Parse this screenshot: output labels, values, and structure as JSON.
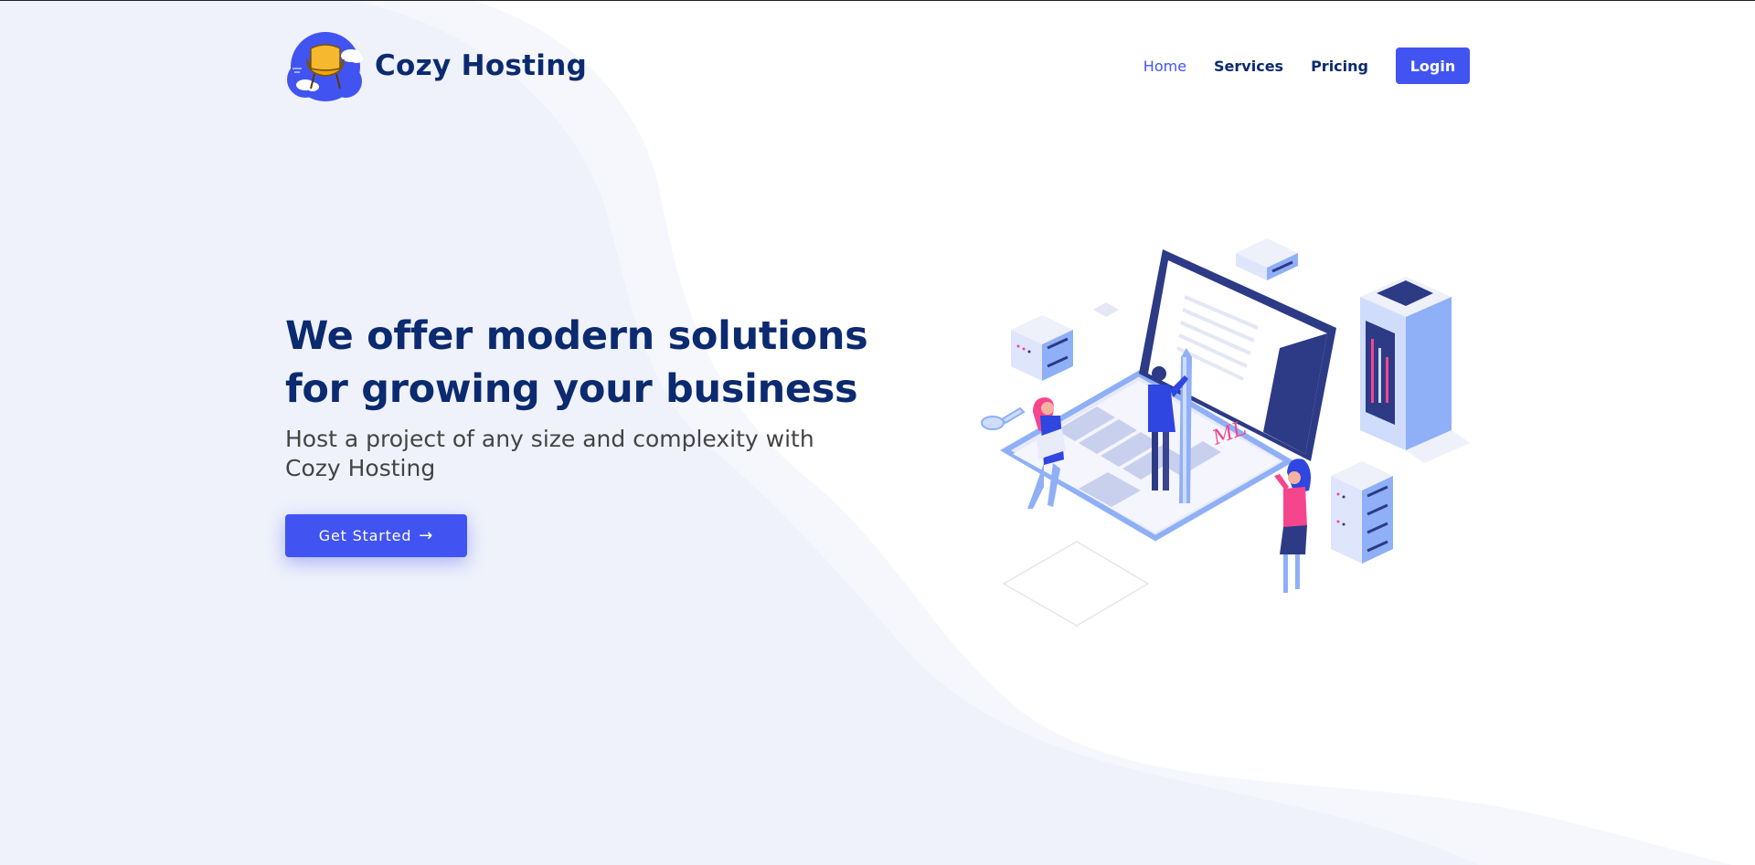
{
  "header": {
    "brand_name": "Cozy Hosting",
    "logo_icon": "cloud-armchair-logo",
    "nav": [
      {
        "label": "Home",
        "active": true
      },
      {
        "label": "Services",
        "active": false
      },
      {
        "label": "Pricing",
        "active": false
      }
    ],
    "login_label": "Login"
  },
  "hero": {
    "title_line1": "We offer modern solutions",
    "title_line2": "for growing your business",
    "subtitle": "Host a project of any size and complexity with Cozy Hosting",
    "cta_label": "Get Started",
    "cta_icon": "arrow-right-icon"
  },
  "illustration": {
    "signature_text": "ML"
  },
  "colors": {
    "accent": "#4154f1",
    "heading": "#0b2a6f",
    "body_text": "#444444",
    "wave_bg": "#f0f3fc",
    "illustration_pink": "#f5468d",
    "illustration_light_blue": "#8fb0f7"
  }
}
